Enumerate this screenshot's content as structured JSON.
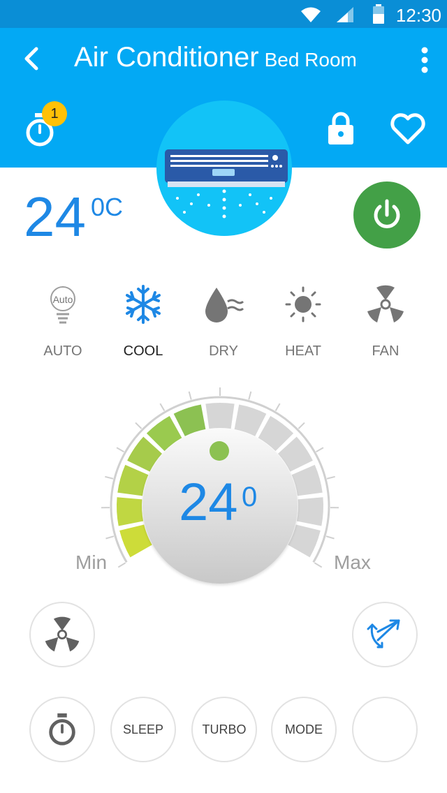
{
  "status_bar": {
    "time": "12:30"
  },
  "header": {
    "title": "Air Conditioner",
    "subtitle": "Bed Room",
    "timer_badge": "1"
  },
  "current_temp": {
    "value": "24",
    "unit": "0C"
  },
  "modes": [
    {
      "label": "AUTO",
      "icon": "auto-bulb-icon",
      "bulb_text": "Auto"
    },
    {
      "label": "COOL",
      "icon": "snowflake-icon"
    },
    {
      "label": "DRY",
      "icon": "drop-icon"
    },
    {
      "label": "HEAT",
      "icon": "sun-icon"
    },
    {
      "label": "FAN",
      "icon": "fan-icon"
    }
  ],
  "dial": {
    "value": "24",
    "superscript": "0",
    "min_label": "Min",
    "max_label": "Max",
    "level": 0.46
  },
  "controls": {
    "sleep": "SLEEP",
    "turbo": "TURBO",
    "mode": "MODE"
  },
  "colors": {
    "header": "#03A9F4",
    "status_bar": "#0A8ED6",
    "accent_blue": "#1E88E5",
    "power": "#43A047",
    "badge": "#FFC107",
    "dial_active": "#8CC152",
    "dial_inactive": "#D6D6D6"
  }
}
